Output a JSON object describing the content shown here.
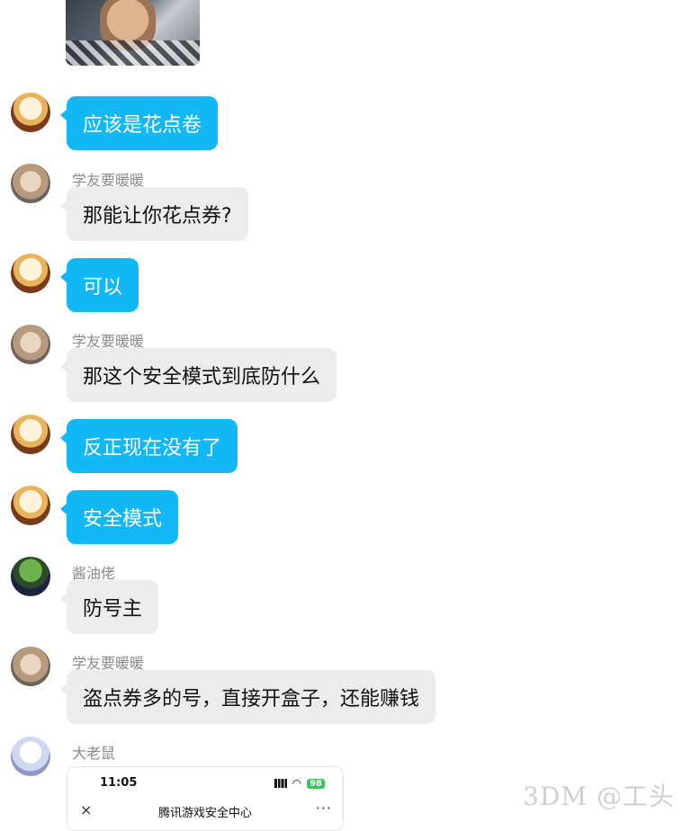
{
  "messages": [
    {
      "sender": "",
      "text": "应该是花点卷"
    },
    {
      "sender": "学友要暖暖",
      "text": "那能让你花点券?"
    },
    {
      "sender": "",
      "text": "可以"
    },
    {
      "sender": "学友要暖暖",
      "text": "那这个安全模式到底防什么"
    },
    {
      "sender": "",
      "text": "反正现在没有了"
    },
    {
      "sender": "",
      "text": "安全模式"
    },
    {
      "sender": "酱油佬",
      "text": "防号主"
    },
    {
      "sender": "学友要暖暖",
      "text": "盗点券多的号，直接开盒子，还能赚钱"
    }
  ],
  "last_sender": "大老鼠",
  "phone_card": {
    "time": "11:05",
    "battery": "98",
    "title": "腾讯游戏安全中心",
    "close_icon": "×",
    "more_icon": "···"
  },
  "watermark": "3DM @工头",
  "colors": {
    "my_bubble": "#12b7f5",
    "other_bubble": "#ececec"
  }
}
